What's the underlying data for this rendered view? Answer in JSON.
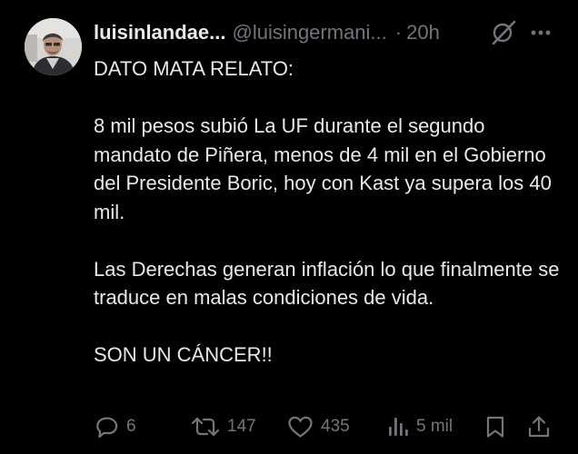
{
  "post": {
    "author": {
      "display_name": "luisinlandae...",
      "handle": "@luisingermani...",
      "avatar": "profile-photo"
    },
    "separator": "·",
    "time": "20h",
    "header_icons": [
      "grok-icon",
      "more-icon"
    ],
    "text": {
      "paragraphs": [
        "DATO MATA RELATO:",
        "8 mil pesos subió La UF durante el segundo mandato de Piñera, menos de 4 mil en el Gobierno del Presidente Boric, hoy con Kast ya supera los 40 mil.",
        "Las Derechas generan inflación lo que finalmente se traduce en malas condiciones de vida.",
        "SON UN CÁNCER!!"
      ]
    },
    "actions": {
      "reply": {
        "icon": "reply-icon",
        "count": "6"
      },
      "repost": {
        "icon": "repost-icon",
        "count": "147"
      },
      "like": {
        "icon": "like-icon",
        "count": "435"
      },
      "views": {
        "icon": "views-icon",
        "count": "5 mil"
      },
      "bookmark": {
        "icon": "bookmark-icon"
      },
      "share": {
        "icon": "share-icon"
      }
    }
  },
  "colors": {
    "background": "#000000",
    "text_primary": "#e7e9ea",
    "text_secondary": "#71767b"
  }
}
